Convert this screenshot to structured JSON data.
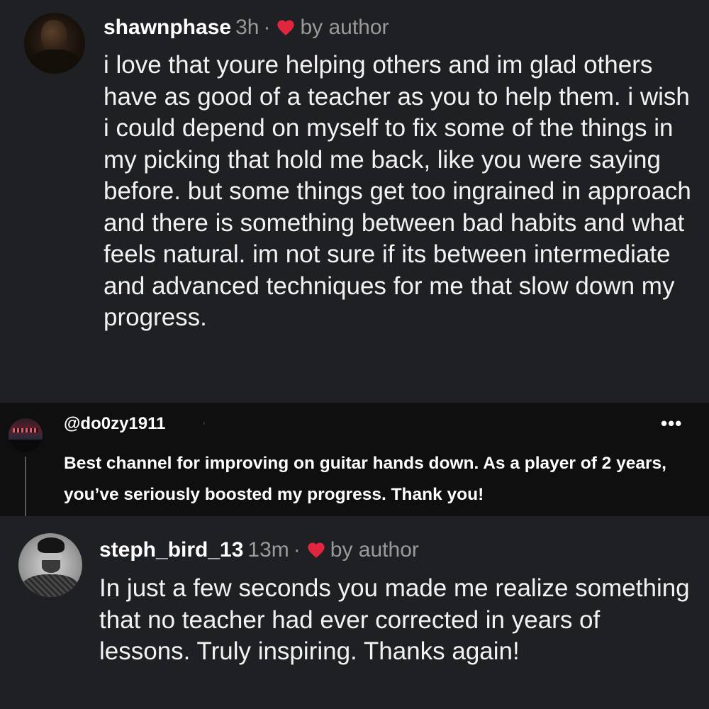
{
  "comments": [
    {
      "username": "shawnphase",
      "time": "3h",
      "separator": "·",
      "liked_label": "by author",
      "text": "i love that youre helping others and im glad others have as good of a teacher as you to help them. i wish i could depend on myself to fix some of the things in my picking that hold me back, like you were saying before. but some things get too ingrained in approach and there is something between bad habits and what feels natural. im not sure if its between intermediate and advanced techniques for me that slow down my progress."
    },
    {
      "handle": "@do0zy1911",
      "faint_mark": "'",
      "more": "•••",
      "text": "Best channel for improving on guitar hands down. As a player of 2 years, you’ve seriously boosted my progress. Thank you!"
    },
    {
      "username": "steph_bird_13",
      "time": "13m",
      "separator": "·",
      "liked_label": "by author",
      "text": "In just a few seconds you made me realize something that no teacher had ever corrected in years of lessons. Truly inspiring. Thanks again!"
    }
  ],
  "icons": {
    "heart": "heart-icon",
    "more": "more-options-icon"
  },
  "colors": {
    "background": "#1e2023",
    "embedded_background": "#0f0f0f",
    "heart": "#e0263e",
    "muted_text": "#9a9a9a",
    "text": "#f2f2f2"
  }
}
